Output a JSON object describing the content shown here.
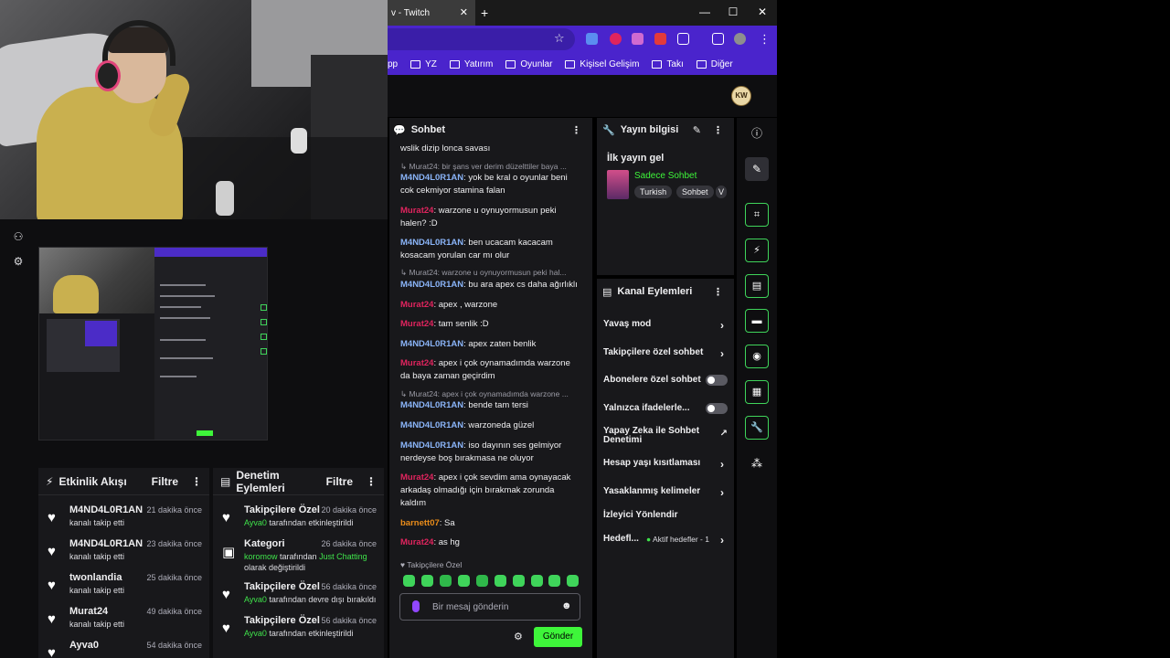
{
  "browser": {
    "tab_title": "v - Twitch",
    "tab_close": "✕",
    "new_tab": "+",
    "window_controls": [
      "—",
      "☐",
      "✕"
    ],
    "bookmarks": [
      "pp",
      "YZ",
      "Yatırım",
      "Oyunlar",
      "Kişisel Gelişim",
      "Takı",
      "Diğer"
    ],
    "avatar_text": "KW"
  },
  "chat": {
    "header": "Sohbet",
    "messages": [
      {
        "user": "",
        "text": "wslik dizip lonca savası"
      },
      {
        "reply": "Murat24: bir şans ver derim düzelttiler baya ..."
      },
      {
        "user": "M4ND4L0R1AN",
        "text": ": yok be kral o oyunlar beni cok cekmiyor stamina falan"
      },
      {
        "user": "Murat24",
        "text": ": warzone u oynuyormusun peki halen? :D"
      },
      {
        "user": "M4ND4L0R1AN",
        "text": ": ben ucacam kacacam kosacam yorulan car mı olur"
      },
      {
        "reply": "Murat24: warzone u oynuyormusun peki hal..."
      },
      {
        "user": "M4ND4L0R1AN",
        "text": ": bu ara apex cs daha ağırlıklı"
      },
      {
        "user": "Murat24",
        "text": ": apex , warzone"
      },
      {
        "user": "Murat24",
        "text": ": tam senlik :D"
      },
      {
        "user": "M4ND4L0R1AN",
        "text": ": apex zaten benlik"
      },
      {
        "user": "Murat24",
        "text": ": apex i çok oynamadımda warzone da baya zaman geçirdim"
      },
      {
        "reply": "Murat24: apex i çok oynamadımda warzone ..."
      },
      {
        "user": "M4ND4L0R1AN",
        "text": ": bende tam tersi"
      },
      {
        "user": "M4ND4L0R1AN",
        "text": ": warzoneda güzel"
      },
      {
        "user": "M4ND4L0R1AN",
        "text": ": iso dayının ses gelmiyor nerdeyse boş bırakmasa ne oluyor"
      },
      {
        "user": "Murat24",
        "text": ": apex i çok sevdim ama oynayacak arkadaş olmadığı için bırakmak zorunda kaldım"
      },
      {
        "user": "barnett07",
        "text": ": Sa"
      },
      {
        "user": "Murat24",
        "text": ": as hg"
      }
    ],
    "followers_only_label": "Takipçilere Özel",
    "input_placeholder": "Bir mesaj gönderin",
    "send_label": "Gönder"
  },
  "stream_info": {
    "header": "Yayın bilgisi",
    "title": "İlk yayın gel",
    "category": "Sadece Sohbet",
    "tags": [
      "Turkish",
      "Sohbet",
      "V"
    ]
  },
  "channel_actions": {
    "header": "Kanal Eylemleri",
    "items": [
      {
        "label": "Yavaş mod"
      },
      {
        "label": "Takipçilere özel sohbet"
      },
      {
        "label": "Abonelere özel sohbet"
      },
      {
        "label": "Yalnızca ifadelerle..."
      },
      {
        "label": "Yapay Zeka ile Sohbet Denetimi"
      },
      {
        "label": "Hesap yaşı kısıtlaması"
      },
      {
        "label": "Yasaklanmış kelimeler"
      },
      {
        "label": "İzleyici Yönlendir"
      },
      {
        "label": "Hedefl...",
        "extra": "Aktif hedefler - 1"
      }
    ]
  },
  "activity_feed": {
    "header": "Etkinlik Akışı",
    "filter": "Filtre",
    "items": [
      {
        "name": "M4ND4L0R1AN",
        "sub": "kanalı takip etti",
        "time": "21 dakika önce"
      },
      {
        "name": "M4ND4L0R1AN",
        "sub": "kanalı takip etti",
        "time": "23 dakika önce"
      },
      {
        "name": "twonlandia",
        "sub": "kanalı takip etti",
        "time": "25 dakika önce"
      },
      {
        "name": "Murat24",
        "sub": "kanalı takip etti",
        "time": "49 dakika önce"
      },
      {
        "name": "Ayva0",
        "sub": "",
        "time": "54 dakika önce"
      }
    ]
  },
  "mod_actions": {
    "header": "Denetim Eylemleri",
    "filter": "Filtre",
    "items": [
      {
        "name": "Takipçilere Özel",
        "user": "Ayva0",
        "sub": " tarafından etkinleştirildi",
        "time": "20 dakika önce"
      },
      {
        "name": "Kategori",
        "user": "koromow",
        "sub": " tarafından ",
        "cat": "Just Chatting",
        "sub2": "olarak değiştirildi",
        "time": "26 dakika önce"
      },
      {
        "name": "Takipçilere Özel",
        "user": "Ayva0",
        "sub": " tarafından devre dışı bırakıldı",
        "time": "56 dakika önce"
      },
      {
        "name": "Takipçilere Özel",
        "user": "Ayva0",
        "sub": " tarafından etkinleştirildi",
        "time": "56 dakika önce"
      }
    ]
  },
  "colors": {
    "twitch_bg": "#0e0e10",
    "panel_bg": "#18181b",
    "accent_green": "#3ef53a",
    "browser_purple": "#4a24cc",
    "user_blue": "#8ab4f8",
    "user_red": "#e0245e"
  }
}
